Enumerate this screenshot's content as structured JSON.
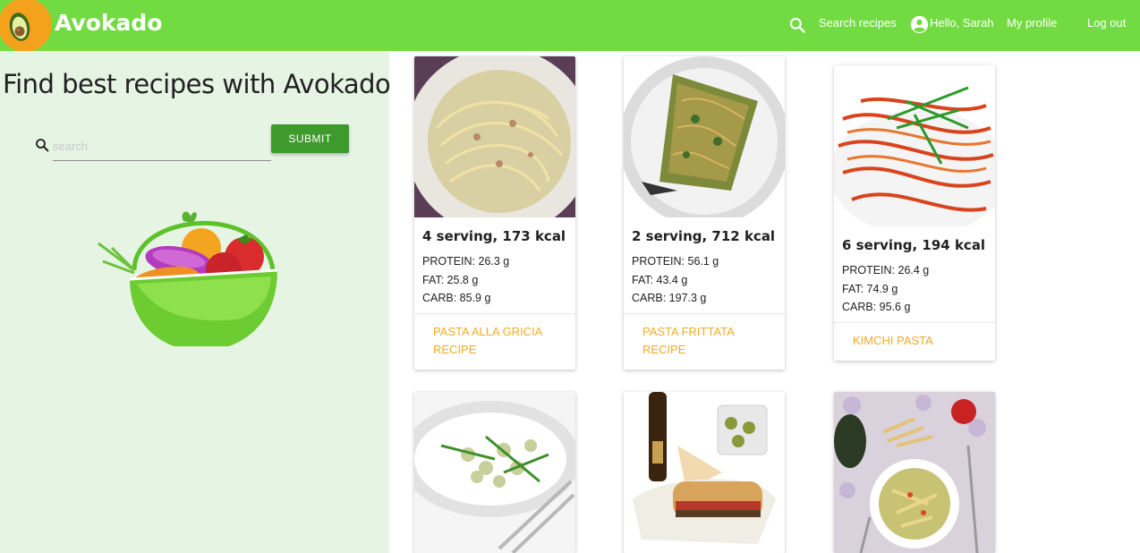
{
  "header": {
    "brand": "Avokado",
    "search_label": "Search recipes",
    "greeting": "Hello, Sarah",
    "profile_label": "My profile",
    "logout_label": "Log out",
    "accent": "#73db42"
  },
  "sidebar": {
    "headline": "Find best recipes with Avokado",
    "search_placeholder": "search",
    "submit_label": "SUBMIT",
    "background": "#e6f4e4"
  },
  "recipes": [
    {
      "title": "4 serving, 173 kcal",
      "protein": "PROTEIN: 26.3 g",
      "fat": "FAT: 25.8 g",
      "carb": "CARB: 85.9 g",
      "link": "PASTA ALLA GRICIA RECIPE"
    },
    {
      "title": "2 serving, 712 kcal",
      "protein": "PROTEIN: 56.1 g",
      "fat": "FAT: 43.4 g",
      "carb": "CARB: 197.3 g",
      "link": "PASTA FRITTATA RECIPE"
    },
    {
      "title": "6 serving, 194 kcal",
      "protein": "PROTEIN: 26.4 g",
      "fat": "FAT: 74.9 g",
      "carb": "CARB: 95.6 g",
      "link": "KIMCHI PASTA"
    },
    {
      "title": "",
      "protein": "",
      "fat": "",
      "carb": "",
      "link": ""
    },
    {
      "title": "",
      "protein": "",
      "fat": "",
      "carb": "",
      "link": ""
    },
    {
      "title": "",
      "protein": "",
      "fat": "",
      "carb": "",
      "link": ""
    }
  ],
  "icons": {
    "brand": "avocado-icon",
    "search": "search-icon",
    "account": "account-circle-icon",
    "basket": "fruit-basket-icon"
  },
  "colors": {
    "link": "#f0ab24",
    "submit": "#3f9a2e"
  }
}
